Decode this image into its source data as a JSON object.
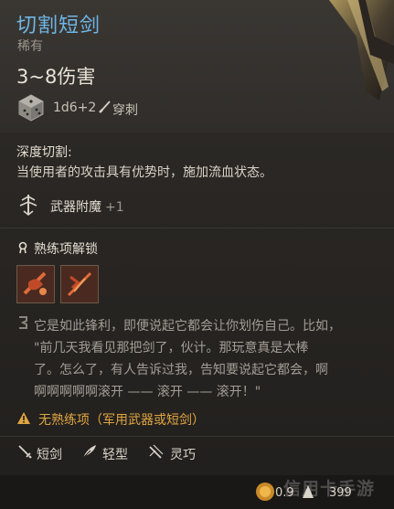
{
  "item": {
    "name": "切割短剑",
    "rarity": "稀有",
    "damage": "3~8伤害",
    "dice": "1d6+2",
    "damage_type": "穿刺",
    "title_color": "#6fb6e6"
  },
  "passive": {
    "name": "深度切割:",
    "description": "当使用者的攻击具有优势时，施加流血状态。"
  },
  "enchant": {
    "label": "武器附魔",
    "bonus": "+1"
  },
  "proficiency": {
    "title": "熟练项解锁",
    "skills": [
      "skill-icon-1",
      "skill-icon-2"
    ]
  },
  "lore": {
    "lines": [
      "它是如此锋利，即便说起它都会让你划伤自己。比如，",
      "\"前几天我看见那把剑了，伙计。那玩意真是太棒",
      "了。怎么了，有人告诉过我，告知要说起它都会，啊",
      "啊啊啊啊啊滚开 —— 滚开 —— 滚开！\""
    ]
  },
  "warning": {
    "text": "无熟练项（军用武器或短剑）",
    "color": "#e0a642"
  },
  "properties": [
    {
      "label": "短剑",
      "icon": "dagger-icon"
    },
    {
      "label": "轻型",
      "icon": "feather-icon"
    },
    {
      "label": "灵巧",
      "icon": "finesse-icon"
    }
  ],
  "footer": {
    "weight": "0.9",
    "value": "399"
  },
  "watermark": "信用卡手游"
}
